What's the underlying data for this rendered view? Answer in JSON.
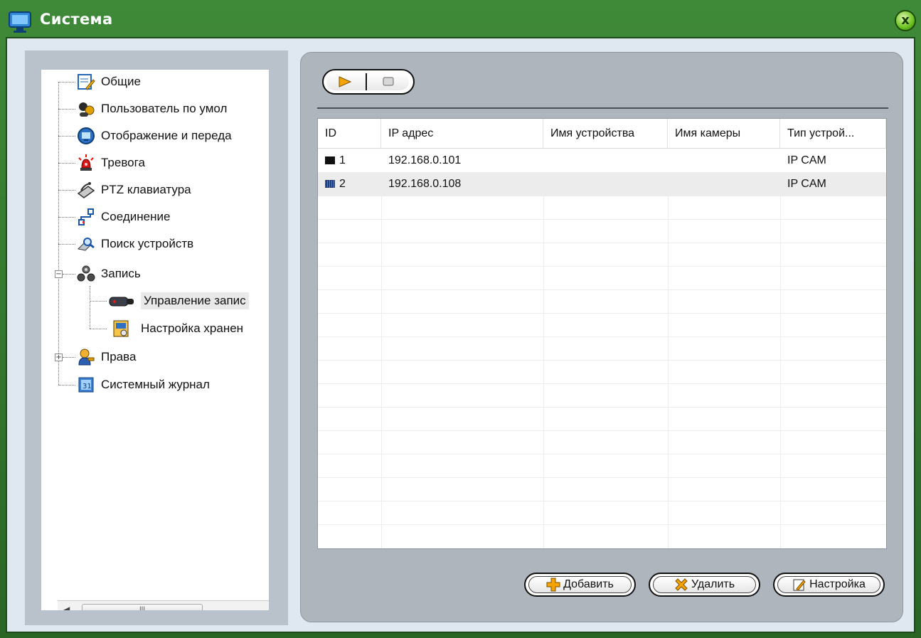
{
  "window": {
    "title": "Система",
    "icons": {
      "app": "monitor-icon",
      "close": "close-icon"
    },
    "close_glyph": "x"
  },
  "tree": {
    "items": [
      {
        "label": "Общие",
        "icon": "general-settings-icon"
      },
      {
        "label": "Пользователь по умол",
        "icon": "default-user-icon"
      },
      {
        "label": "Отображение и переда",
        "icon": "display-icon"
      },
      {
        "label": "Тревога",
        "icon": "alarm-siren-icon"
      },
      {
        "label": "PTZ клавиатура",
        "icon": "ptz-keyboard-icon"
      },
      {
        "label": "Соединение",
        "icon": "network-connection-icon"
      },
      {
        "label": "Поиск устройств",
        "icon": "device-search-icon"
      },
      {
        "label": "Запись",
        "icon": "recording-group-icon"
      },
      {
        "label": "Управление запис",
        "icon": "camera-recording-icon"
      },
      {
        "label": "Настройка хранен",
        "icon": "storage-settings-icon"
      },
      {
        "label": "Права",
        "icon": "users-permissions-icon"
      },
      {
        "label": "Системный журнал",
        "icon": "system-log-icon"
      }
    ],
    "selected": "Управление запис",
    "expander_minus": "−",
    "expander_plus": "+",
    "scroll_left": "◀",
    "scroll_right": "▶",
    "scroll_thumb": "III"
  },
  "toolbar": {
    "play_icon": "play-icon",
    "stop_icon": "stop-icon"
  },
  "grid": {
    "columns": [
      "ID",
      "IP адрес",
      "Имя устройства",
      "Имя камеры",
      "Тип устрой..."
    ],
    "rows": [
      {
        "id": "1",
        "ip": "192.168.0.101",
        "device": "",
        "camera": "",
        "type": "IP CAM"
      },
      {
        "id": "2",
        "ip": "192.168.0.108",
        "device": "",
        "camera": "",
        "type": "IP CAM"
      }
    ]
  },
  "buttons": {
    "add": "Добавить",
    "delete": "Удалить",
    "settings": "Настройка"
  },
  "colors": {
    "title_bar": "#3f8a38",
    "accent_orange": "#f5a300"
  }
}
